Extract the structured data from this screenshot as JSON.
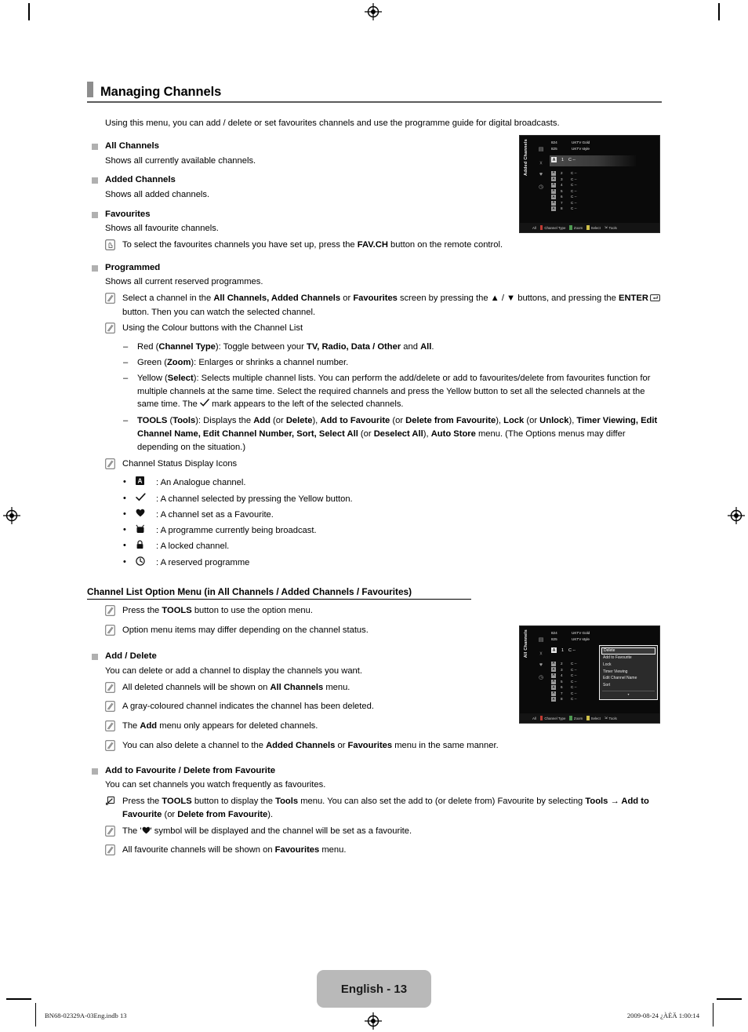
{
  "page": {
    "title": "Managing Channels",
    "intro": "Using this menu, you can add / delete or set favourites channels and use the programme guide for digital broadcasts.",
    "page_badge": "English - 13",
    "footer_left": "BN68-02329A-03Eng.indb   13",
    "footer_right": "2009-08-24   ¿ÀÈÄ 1:00:14"
  },
  "sections": {
    "all_channels": {
      "heading": "All Channels",
      "body": "Shows all currently available channels."
    },
    "added_channels": {
      "heading": "Added Channels",
      "body": "Shows all added channels."
    },
    "favourites": {
      "heading": "Favourites",
      "body": "Shows all favourite channels.",
      "note_icon": "press-button-icon",
      "note_1a": "To select the favourites channels you have set up, press the ",
      "note_1b": "FAV.CH",
      "note_1c": " button on the remote control."
    },
    "programmed": {
      "heading": "Programmed",
      "body": "Shows all current reserved programmes.",
      "note_1": {
        "icon": "note-pencil-icon",
        "t1": "Select a channel in the ",
        "b1": "All Channels, Added Channels",
        "t2": " or ",
        "b2": "Favourites",
        "t3": " screen by pressing the ▲ / ▼ buttons, and pressing the ",
        "b3": "ENTER",
        "t4": " button. Then you can watch the selected channel.",
        "enter_key_icon": "enter-key-icon"
      },
      "note_2": {
        "icon": "note-pencil-icon",
        "text": "Using the Colour buttons with the Channel List"
      },
      "dashes": [
        {
          "t1": "Red (",
          "b1": "Channel Type",
          "t2": "): Toggle between your ",
          "b2": "TV, Radio, Data / Other",
          "t3": " and ",
          "b3": "All",
          "t4": "."
        },
        {
          "t1": "Green (",
          "b1": "Zoom",
          "t2": "): Enlarges or shrinks a channel number.",
          "b2": "",
          "t3": "",
          "b3": "",
          "t4": ""
        }
      ],
      "dash_yellow": {
        "t1": "Yellow (",
        "b1": "Select",
        "t2": "): Selects multiple channel lists. You can perform the add/delete or add to favourites/delete from favourites function for multiple channels at the same time. Select the required channels and press the Yellow button to set all the selected channels at the same time. The ",
        "check_icon": "checkmark-icon",
        "t3": " mark appears to the left of the selected channels."
      },
      "dash_tools": {
        "b0": "TOOLS",
        "t0": " (",
        "b0b": "Tools",
        "t0b": "): Displays the ",
        "b1": "Add",
        "t1": " (or ",
        "b2": "Delete",
        "t2": "), ",
        "b3": "Add to Favourite",
        "t3": " (or ",
        "b4": "Delete from Favourite",
        "t4": "), ",
        "b5": "Lock",
        "t5": " (or ",
        "b6": "Unlock",
        "t6": "), ",
        "b7": "Timer Viewing, Edit Channel Name, Edit Channel Number, Sort, Select All",
        "t7": " (or ",
        "b8": "Deselect All",
        "t8": "), ",
        "b9": "Auto Store",
        "t9": " menu. (The Options menus may differ depending on the situation.)"
      },
      "status_note": {
        "icon": "note-pencil-icon",
        "text": "Channel Status Display Icons"
      },
      "status_icons": [
        {
          "icon": "analogue-a-icon",
          "glyph": "A",
          "text": ": An Analogue channel."
        },
        {
          "icon": "checkmark-icon",
          "glyph": "✓",
          "text": ": A channel selected by pressing the Yellow button."
        },
        {
          "icon": "heart-icon",
          "glyph": "♥",
          "text": ": A channel set as a Favourite."
        },
        {
          "icon": "tv-broadcast-icon",
          "glyph": "📺",
          "text": ": A programme currently being broadcast."
        },
        {
          "icon": "lock-icon",
          "glyph": "🔒",
          "text": ": A locked channel."
        },
        {
          "icon": "clock-icon",
          "glyph": "🕓",
          "text": ": A reserved programme"
        }
      ]
    },
    "option_menu": {
      "heading": "Channel List Option Menu (in All Channels / Added Channels / Favourites)",
      "note_1": {
        "icon": "note-pencil-icon",
        "t1": "Press the ",
        "b1": "TOOLS",
        "t2": " button to use the option menu."
      },
      "note_2": {
        "icon": "note-pencil-icon",
        "text": "Option menu items may differ depending on the channel status."
      }
    },
    "add_delete": {
      "heading": "Add / Delete",
      "body": "You can delete or add a channel to display the channels you want.",
      "notes": [
        {
          "icon": "note-pencil-icon",
          "t1": "All deleted channels will be shown on ",
          "b1": "All Channels",
          "t2": " menu."
        },
        {
          "icon": "note-pencil-icon",
          "t1": "A gray-coloured channel indicates the channel has been deleted.",
          "b1": "",
          "t2": ""
        },
        {
          "icon": "note-pencil-icon",
          "t1": "The ",
          "b1": "Add",
          "t2": " menu only appears for deleted channels."
        },
        {
          "icon": "note-pencil-icon",
          "t1": "You can also delete a channel to the ",
          "b1": "Added Channels",
          "t2": " or ",
          "b2": "Favourites",
          "t3": " menu in the same manner."
        }
      ]
    },
    "add_favourite": {
      "heading": "Add to Favourite / Delete from Favourite",
      "body": "You can set channels you watch frequently as favourites.",
      "note_tools": {
        "icon": "tools-icon",
        "t1": "Press the ",
        "b1": "TOOLS",
        "t2": " button to display the ",
        "b2": "Tools",
        "t3": " menu. You can also set the add to (or delete from) Favourite by selecting ",
        "b3": "Tools → Add to Favourite",
        "t4": " (or ",
        "b4": "Delete from Favourite",
        "t5": ")."
      },
      "note_heart": {
        "icon": "note-pencil-icon",
        "t1": "The '",
        "glyph": "♥",
        "t2": "' symbol will be displayed and the channel will be set as a favourite."
      },
      "note_all": {
        "icon": "note-pencil-icon",
        "t1": "All favourite channels will be shown on ",
        "b1": "Favourites",
        "t2": " menu."
      }
    }
  },
  "tv_added": {
    "sidebar_label": "Added Channels",
    "top_rows": [
      {
        "num": "824",
        "name": "UKTV Gold"
      },
      {
        "num": "825",
        "name": "UKTV style"
      }
    ],
    "selected_row": {
      "badge": "A",
      "num": "1",
      "name": "C --"
    },
    "rows": [
      {
        "badge": "A",
        "num": "2",
        "name": "C --"
      },
      {
        "badge": "A",
        "num": "3",
        "name": "C --"
      },
      {
        "badge": "A",
        "num": "4",
        "name": "C --"
      },
      {
        "badge": "A",
        "num": "5",
        "name": "C --"
      },
      {
        "badge": "A",
        "num": "6",
        "name": "C --"
      },
      {
        "badge": "A",
        "num": "7",
        "name": "C --"
      },
      {
        "badge": "A",
        "num": "8",
        "name": "C --"
      }
    ],
    "side_icons": [
      "tv-broadcast-icon",
      "no-signal-icon",
      "heart-icon",
      "clock-icon"
    ],
    "footer": {
      "all": "All",
      "channel_type": "Channel Type",
      "zoom": "Zoom",
      "select": "Select",
      "tools": "Tools"
    }
  },
  "tv_all": {
    "sidebar_label": "All Channels",
    "top_rows": [
      {
        "num": "824",
        "name": "UKTV Gold"
      },
      {
        "num": "825",
        "name": "UKTV style"
      }
    ],
    "selected_row": {
      "badge": "A",
      "num": "1",
      "name": "C --"
    },
    "rows": [
      {
        "badge": "A",
        "num": "2",
        "name": "C --"
      },
      {
        "badge": "A",
        "num": "3",
        "name": "C --"
      },
      {
        "badge": "A",
        "num": "4",
        "name": "C --"
      },
      {
        "badge": "A",
        "num": "5",
        "name": "C --"
      },
      {
        "badge": "A",
        "num": "6",
        "name": "C --"
      },
      {
        "badge": "A",
        "num": "7",
        "name": "C --"
      },
      {
        "badge": "A",
        "num": "8",
        "name": "C --"
      }
    ],
    "side_icons": [
      "tv-broadcast-icon",
      "no-signal-icon",
      "heart-icon",
      "clock-icon"
    ],
    "menu": {
      "items": [
        "Delete",
        "Add to Favourite",
        "Lock",
        "Timer Viewing",
        "Edit Channel Name",
        "Sort"
      ],
      "selected_index": 0,
      "more_arrow": "▾"
    },
    "footer": {
      "all": "All",
      "channel_type": "Channel Type",
      "zoom": "Zoom",
      "select": "Select",
      "tools": "Tools"
    }
  },
  "colors": {
    "accent_gray": "#b9b9b9",
    "rule": "#5b5b5b",
    "red_key": "#c03b33",
    "green_key": "#4e9a52",
    "yellow_key": "#cfc04a"
  }
}
